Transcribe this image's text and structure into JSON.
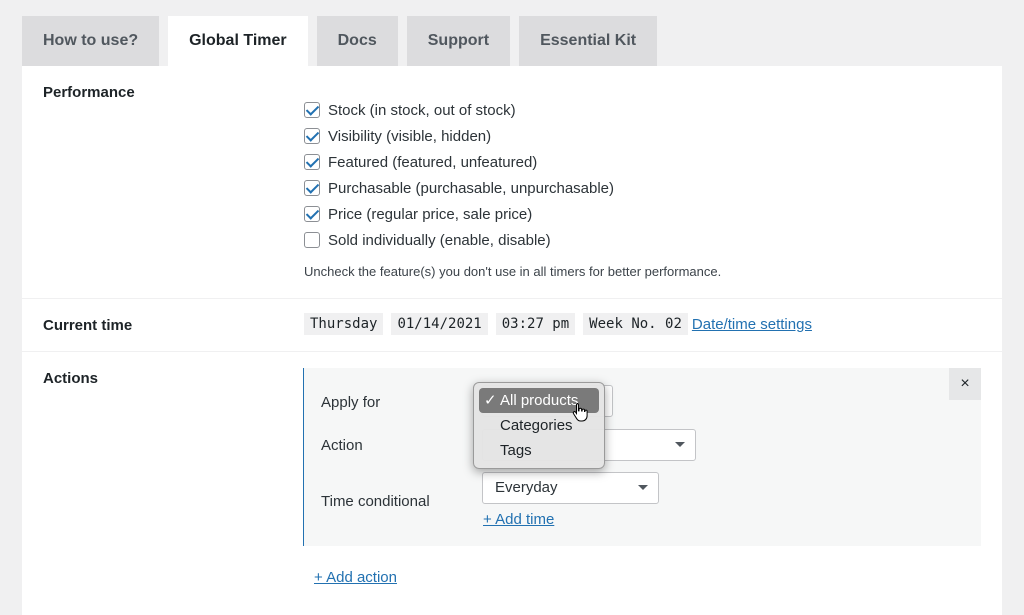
{
  "tabs": [
    {
      "label": "How to use?",
      "active": false
    },
    {
      "label": "Global Timer",
      "active": true
    },
    {
      "label": "Docs",
      "active": false
    },
    {
      "label": "Support",
      "active": false
    },
    {
      "label": "Essential Kit",
      "active": false
    }
  ],
  "performance": {
    "label": "Performance",
    "items": [
      {
        "label": "Stock (in stock, out of stock)",
        "checked": true
      },
      {
        "label": "Visibility (visible, hidden)",
        "checked": true
      },
      {
        "label": "Featured (featured, unfeatured)",
        "checked": true
      },
      {
        "label": "Purchasable (purchasable, unpurchasable)",
        "checked": true
      },
      {
        "label": "Price (regular price, sale price)",
        "checked": true
      },
      {
        "label": "Sold individually (enable, disable)",
        "checked": false
      }
    ],
    "hint": "Uncheck the feature(s) you don't use in all timers for better performance."
  },
  "current_time": {
    "label": "Current time",
    "day": "Thursday",
    "date": "01/14/2021",
    "time": "03:27 pm",
    "week": "Week No. 02",
    "settings_link": "Date/time settings"
  },
  "actions": {
    "label": "Actions",
    "close": "×",
    "apply_for_label": "Apply for",
    "action_label": "Action",
    "time_conditional_label": "Time conditional",
    "time_conditional_value": "Everyday",
    "add_time": "+ Add time",
    "add_action": "+ Add action",
    "dropdown": {
      "check": "✓",
      "options": [
        {
          "label": "All products",
          "selected": true
        },
        {
          "label": "Categories",
          "selected": false
        },
        {
          "label": "Tags",
          "selected": false
        }
      ]
    }
  },
  "colors": {
    "accent": "#2271b1",
    "background": "#f0f0f1",
    "tab_inactive": "#dcdcde"
  }
}
